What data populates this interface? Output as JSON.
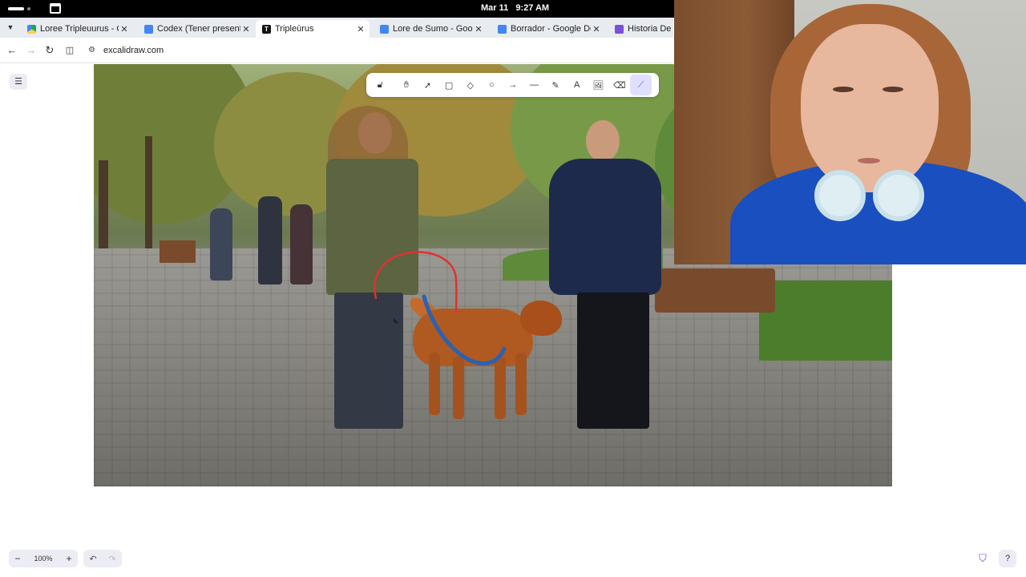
{
  "os_bar": {
    "date": "Mar 11",
    "time": "9:27 AM"
  },
  "browser": {
    "tabs": [
      {
        "label": "Loree Tripleuurus - Go",
        "favicon": "google-drive-icon",
        "active": false
      },
      {
        "label": "Codex (Tener presente",
        "favicon": "google-docs-icon",
        "active": false
      },
      {
        "label": "Tripleūrus",
        "favicon": "t-letter-icon",
        "active": true
      },
      {
        "label": "Lore de Sumo - Googl",
        "favicon": "google-docs-icon",
        "active": false
      },
      {
        "label": "Borrador - Google Doc",
        "favicon": "google-docs-icon",
        "active": false
      },
      {
        "label": "Historia De Lo",
        "favicon": "game-icon",
        "active": false
      }
    ],
    "url": "excalidraw.com"
  },
  "excalidraw": {
    "toolbar": [
      {
        "name": "lock",
        "icon": "lock-icon",
        "glyph": "🔓︎",
        "active": false
      },
      {
        "name": "hand",
        "icon": "hand-icon",
        "glyph": "✋︎",
        "active": false
      },
      {
        "name": "selection",
        "icon": "pointer-icon",
        "glyph": "➚",
        "active": false
      },
      {
        "name": "rectangle",
        "icon": "rectangle-icon",
        "glyph": "▢",
        "active": false
      },
      {
        "name": "diamond",
        "icon": "diamond-icon",
        "glyph": "◇",
        "active": false
      },
      {
        "name": "ellipse",
        "icon": "ellipse-icon",
        "glyph": "○",
        "active": false
      },
      {
        "name": "arrow",
        "icon": "arrow-icon",
        "glyph": "→",
        "active": false
      },
      {
        "name": "line",
        "icon": "line-icon",
        "glyph": "—",
        "active": false
      },
      {
        "name": "draw",
        "icon": "pencil-icon",
        "glyph": "✎",
        "active": false
      },
      {
        "name": "text",
        "icon": "text-icon",
        "glyph": "A",
        "active": false
      },
      {
        "name": "image",
        "icon": "image-icon",
        "glyph": "🖼︎",
        "active": false
      },
      {
        "name": "eraser",
        "icon": "eraser-icon",
        "glyph": "⌫",
        "active": false
      },
      {
        "name": "laser",
        "icon": "laser-pointer-icon",
        "glyph": "⟋",
        "active": true
      }
    ],
    "zoom_level": "100%",
    "annotation_color": "#e03131",
    "leash_color": "#2a62b0"
  }
}
